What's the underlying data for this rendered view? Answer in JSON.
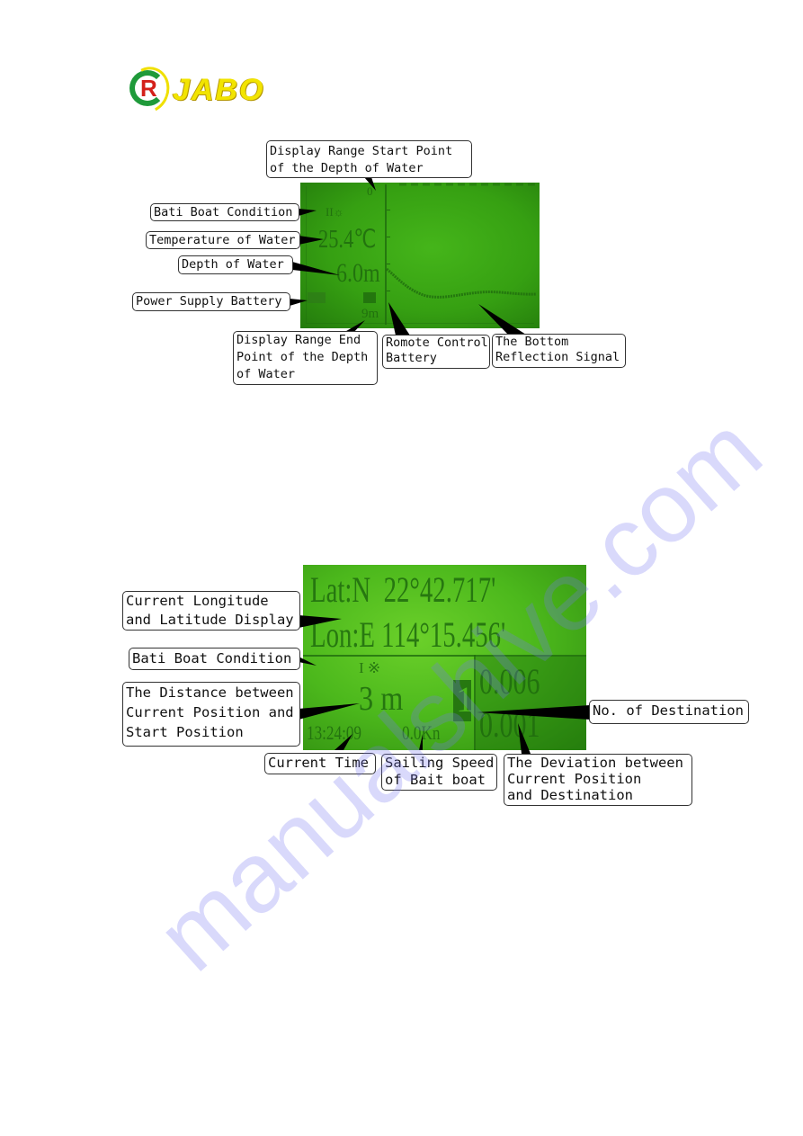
{
  "logo": {
    "badge_letter": "R",
    "brand": "JABO"
  },
  "sonar_display": {
    "screen": {
      "range_start": "0",
      "boat_condition": "II☼",
      "water_temperature": "25.4℃",
      "water_depth": "6.0m",
      "range_end": "9m"
    },
    "callouts": {
      "range_start": "Display Range Start Point\nof the Depth of Water",
      "boat_condition": "Bati Boat Condition",
      "temperature": "Temperature of Water",
      "depth": "Depth of Water",
      "power_battery": "Power Supply Battery",
      "range_end": "Display Range End\nPoint of the Depth\nof Water",
      "remote_battery": "Romote Control\nBattery",
      "bottom_signal": "The Bottom\nReflection Signal"
    }
  },
  "gps_display": {
    "screen": {
      "latitude": "Lat:N  22°42.717'",
      "longitude": "Lon:E 114°15.456'",
      "boat_condition": "I ※",
      "distance": "3 m",
      "destination_no": "1",
      "deviation_1": "0.006",
      "deviation_2": "0.001",
      "time": "13:24:09",
      "speed": "0.0Kn"
    },
    "callouts": {
      "lat_lon": "Current Longitude\nand Latitude Display",
      "boat_condition": "Bati Boat Condition",
      "distance": "The Distance between\nCurrent Position and\nStart Position",
      "time": "Current Time",
      "speed": "Sailing Speed\nof Bait boat",
      "destination": "No. of Destination",
      "deviation": "The Deviation between\nCurrent Position\nand Destination"
    }
  },
  "watermark": "manualshive.com"
}
